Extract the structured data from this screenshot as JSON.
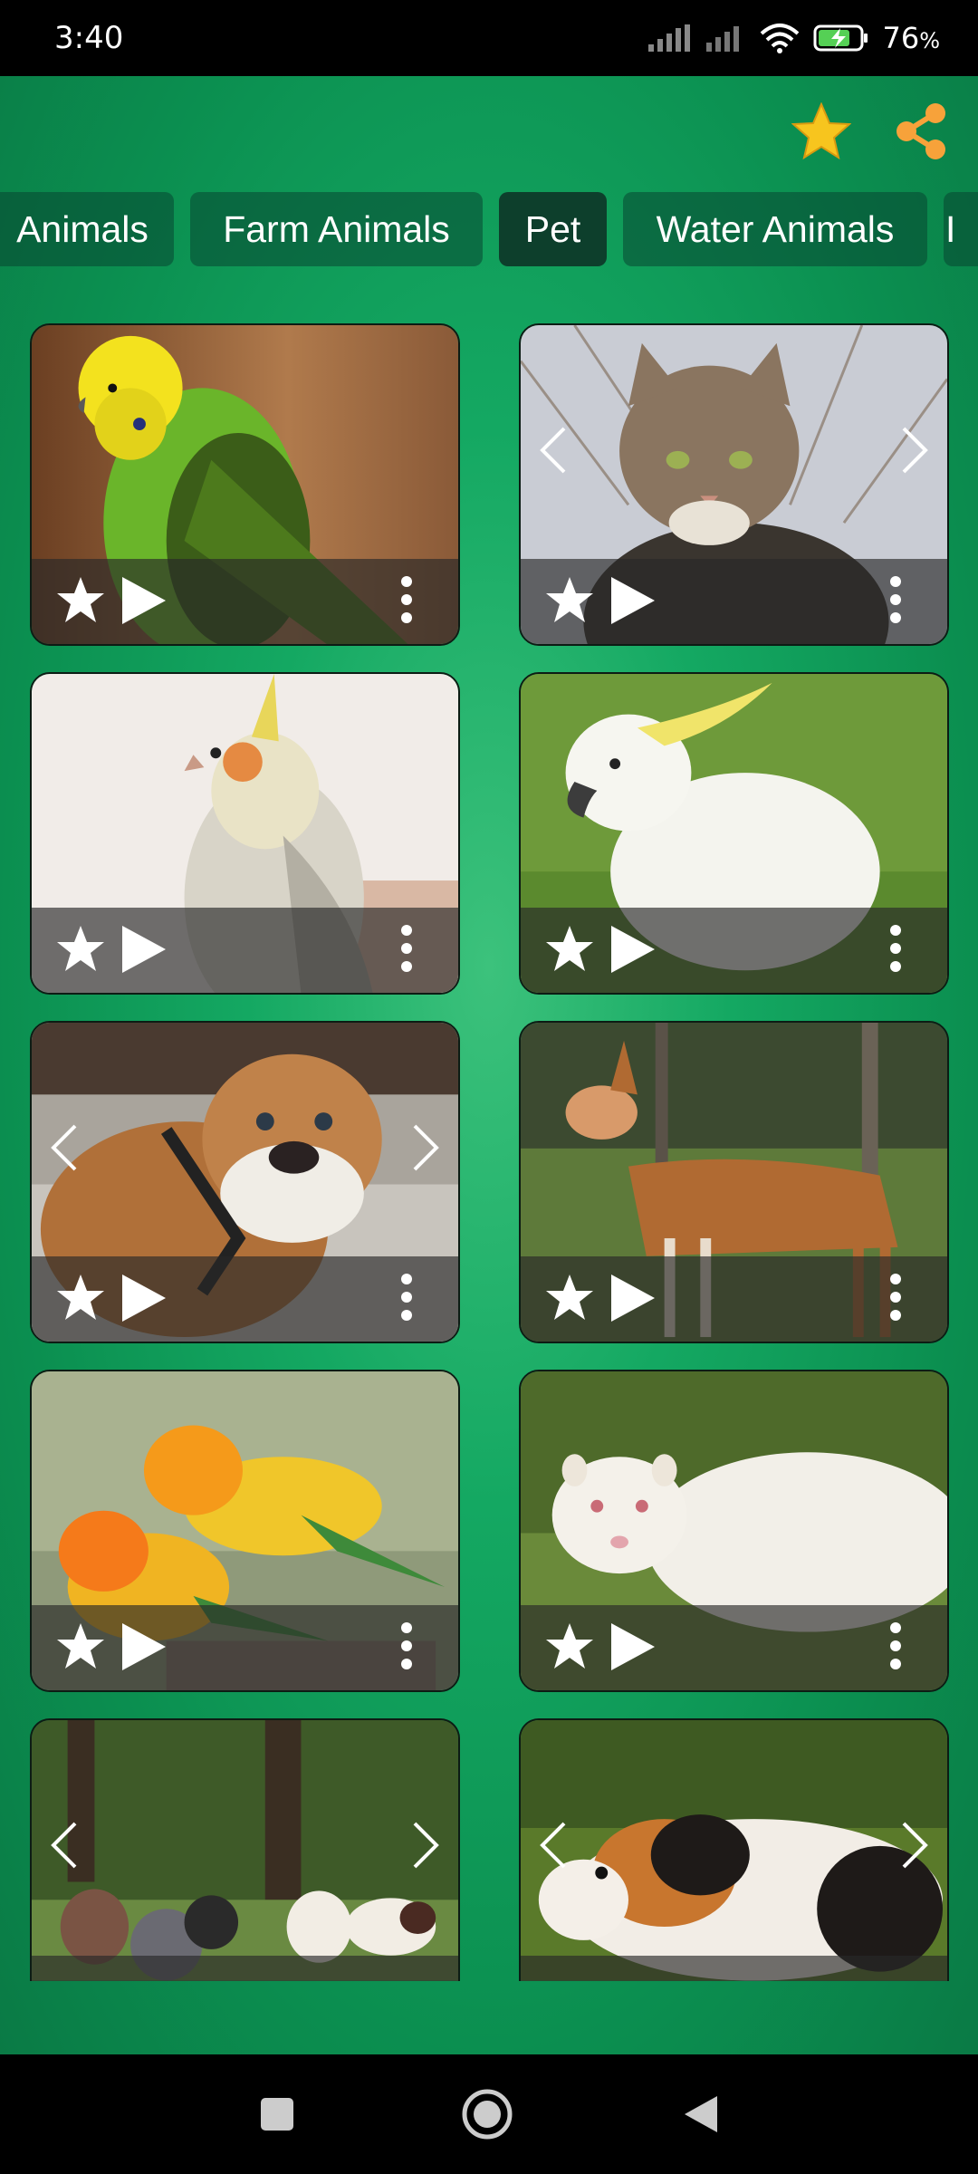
{
  "status": {
    "time": "3:40",
    "battery": "76",
    "battery_unit": "%"
  },
  "header": {
    "favorite_icon": "star-icon",
    "share_icon": "share-icon"
  },
  "tabs": [
    {
      "label": "Animals",
      "active": false
    },
    {
      "label": "Farm Animals",
      "active": false
    },
    {
      "label": "Pet",
      "active": true
    },
    {
      "label": "Water Animals",
      "active": false
    },
    {
      "label": "I",
      "active": false
    }
  ],
  "cards": [
    {
      "name": "budgie",
      "has_arrows": false
    },
    {
      "name": "cat",
      "has_arrows": true
    },
    {
      "name": "cockatiel",
      "has_arrows": false
    },
    {
      "name": "cockatoo",
      "has_arrows": false
    },
    {
      "name": "bulldog",
      "has_arrows": true
    },
    {
      "name": "hound",
      "has_arrows": false
    },
    {
      "name": "conures",
      "has_arrows": false
    },
    {
      "name": "ferret",
      "has_arrows": false
    },
    {
      "name": "puppies",
      "has_arrows": true
    },
    {
      "name": "guinea-pig",
      "has_arrows": true
    }
  ],
  "colors": {
    "accent_star": "#f7c51e",
    "share": "#f7a23a",
    "tab_bg": "#0d4f37",
    "tab_active": "#0d3f2c"
  }
}
